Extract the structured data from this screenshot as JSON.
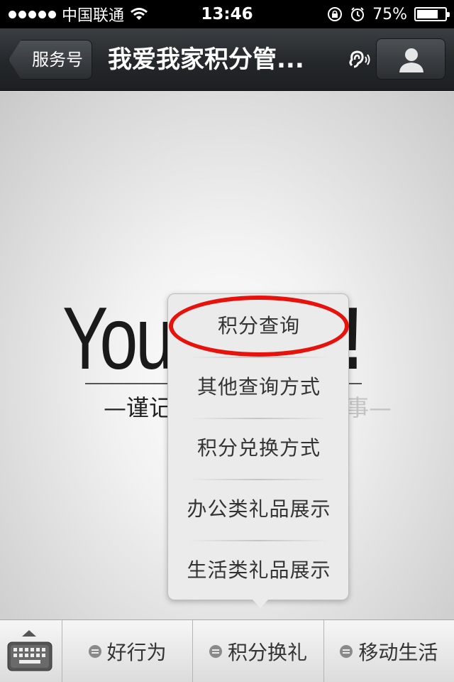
{
  "status_bar": {
    "carrier": "中国联通",
    "time": "13:46",
    "battery_percent": "75%",
    "battery_level": 0.75
  },
  "nav": {
    "back_label": "服务号",
    "title": "我爱我家积分管...",
    "ear_icon": "ear-speaker-icon",
    "profile_icon": "person-icon"
  },
  "content": {
    "logo_main": "You",
    "logo_tail": "!",
    "slogan_left": "—谨记",
    "slogan_right": "每天要做的事—"
  },
  "popup": {
    "items": [
      {
        "label": "积分查询"
      },
      {
        "label": "其他查询方式"
      },
      {
        "label": "积分兑换方式"
      },
      {
        "label": "办公类礼品展示"
      },
      {
        "label": "生活类礼品展示"
      }
    ],
    "highlight_color": "#e8120c"
  },
  "bottom_bar": {
    "keyboard_icon": "keyboard-icon",
    "tabs": [
      {
        "label": "好行为",
        "icon": "menu-icon"
      },
      {
        "label": "积分换礼",
        "icon": "menu-icon"
      },
      {
        "label": "移动生活",
        "icon": "menu-icon"
      }
    ]
  }
}
